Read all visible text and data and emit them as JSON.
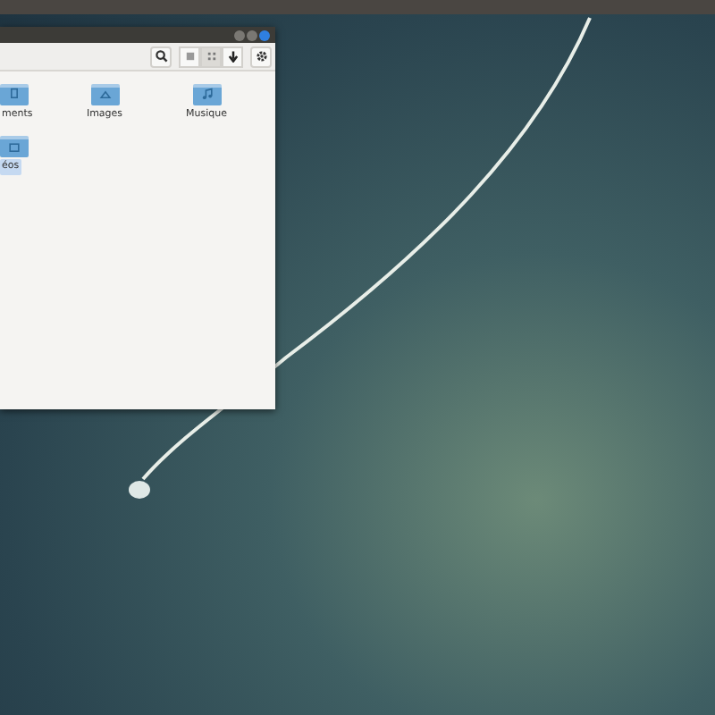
{
  "window": {
    "title_buttons": [
      {
        "kind": "minimize"
      },
      {
        "kind": "maximize"
      },
      {
        "kind": "close"
      }
    ],
    "toolbar": {
      "view_buttons": [
        {
          "kind": "list",
          "selected": false
        },
        {
          "kind": "grid",
          "selected": true
        },
        {
          "kind": "sort",
          "selected": false
        }
      ]
    },
    "files": [
      {
        "label": "ments",
        "kind": "documents",
        "selected": false
      },
      {
        "label": "Images",
        "kind": "pictures",
        "selected": false
      },
      {
        "label": "Musique",
        "kind": "music",
        "selected": false
      },
      {
        "label": "éos",
        "kind": "videos",
        "selected": true
      }
    ]
  }
}
